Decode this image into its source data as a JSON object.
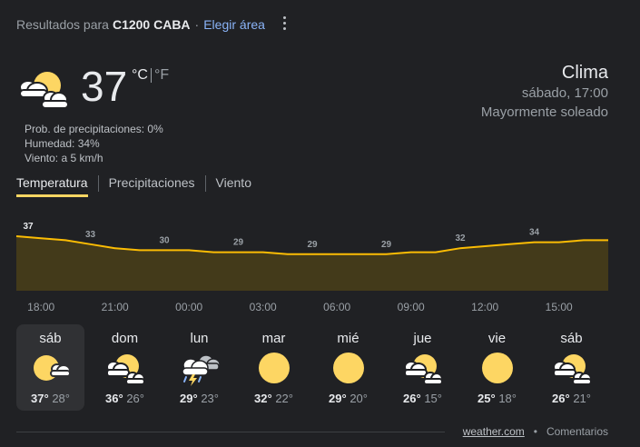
{
  "location": {
    "prefix": "Resultados para",
    "place": "C1200 CABA",
    "separator": "·",
    "change_link": "Elegir área"
  },
  "current": {
    "icon": "partly-sunny-icon",
    "temperature": "37",
    "unit_c": "°C",
    "unit_f": "°F",
    "precip": "Prob. de precipitaciones: 0%",
    "humidity": "Humedad: 34%",
    "wind": "Viento: a 5 km/h"
  },
  "header": {
    "title": "Clima",
    "datetime": "sábado, 17:00",
    "condition": "Mayormente soleado"
  },
  "tabs": [
    {
      "label": "Temperatura",
      "active": true
    },
    {
      "label": "Precipitaciones",
      "active": false
    },
    {
      "label": "Viento",
      "active": false
    }
  ],
  "chart_data": {
    "type": "area",
    "x": [
      "17:00",
      "18:00",
      "19:00",
      "20:00",
      "21:00",
      "22:00",
      "23:00",
      "00:00",
      "01:00",
      "02:00",
      "03:00",
      "04:00",
      "05:00",
      "06:00",
      "07:00",
      "08:00",
      "09:00",
      "10:00",
      "11:00",
      "12:00",
      "13:00",
      "14:00",
      "15:00",
      "16:00",
      "17:00"
    ],
    "values": [
      37,
      36,
      35,
      33,
      31,
      30,
      30,
      30,
      29,
      29,
      29,
      28,
      28,
      28,
      28,
      28,
      29,
      29,
      31,
      32,
      33,
      34,
      34,
      35,
      35
    ],
    "labels": [
      {
        "hour": "17:00",
        "value": "37"
      },
      {
        "hour": "20:00",
        "value": "33"
      },
      {
        "hour": "23:00",
        "value": "30"
      },
      {
        "hour": "02:00",
        "value": "29"
      },
      {
        "hour": "05:00",
        "value": "29"
      },
      {
        "hour": "08:00",
        "value": "29"
      },
      {
        "hour": "11:00",
        "value": "32"
      },
      {
        "hour": "14:00",
        "value": "34"
      }
    ],
    "time_ticks": [
      "18:00",
      "21:00",
      "00:00",
      "03:00",
      "06:00",
      "09:00",
      "12:00",
      "15:00"
    ],
    "line_color": "#fbbc04",
    "fill_color": "#433a1a"
  },
  "forecast": [
    {
      "day": "sáb",
      "icon": "sun-cloud-icon",
      "hi": "37°",
      "lo": "28°",
      "selected": true
    },
    {
      "day": "dom",
      "icon": "partly-cloudy-icon",
      "hi": "36°",
      "lo": "26°"
    },
    {
      "day": "lun",
      "icon": "thunderstorm-icon",
      "hi": "29°",
      "lo": "23°"
    },
    {
      "day": "mar",
      "icon": "sun-icon",
      "hi": "32°",
      "lo": "22°"
    },
    {
      "day": "mié",
      "icon": "sun-icon",
      "hi": "29°",
      "lo": "20°"
    },
    {
      "day": "jue",
      "icon": "partly-cloudy-icon",
      "hi": "26°",
      "lo": "15°"
    },
    {
      "day": "vie",
      "icon": "sun-icon",
      "hi": "25°",
      "lo": "18°"
    },
    {
      "day": "sáb",
      "icon": "partly-cloudy-icon",
      "hi": "26°",
      "lo": "21°"
    }
  ],
  "footer": {
    "source": "weather.com",
    "dot": "•",
    "feedback": "Comentarios"
  },
  "colors": {
    "background": "#202124",
    "accent": "#fdd663",
    "link": "#8ab4f8"
  }
}
